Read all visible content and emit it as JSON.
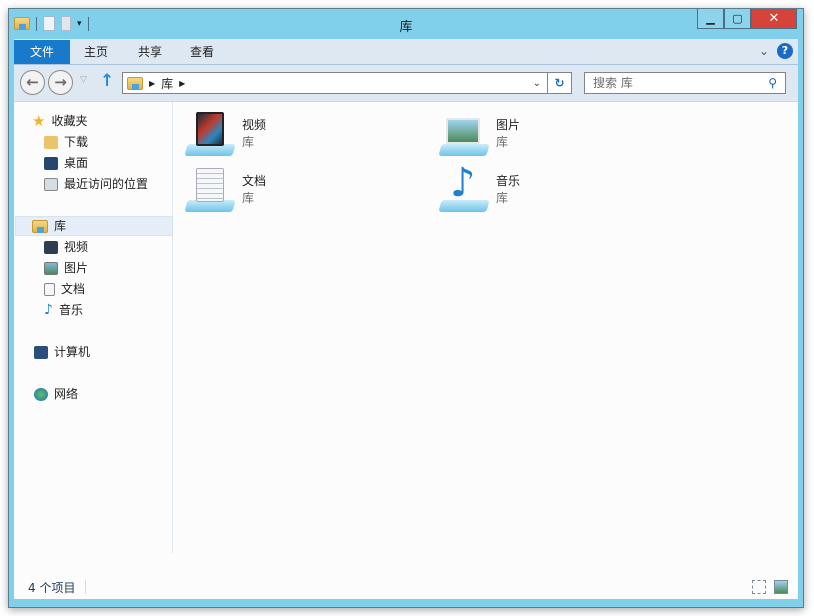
{
  "window": {
    "title": "库"
  },
  "ribbon": {
    "tabs": [
      "文件",
      "主页",
      "共享",
      "查看"
    ]
  },
  "nav": {
    "breadcrumb": [
      "库"
    ],
    "search_placeholder": "搜索 库"
  },
  "sidebar": {
    "favorites": {
      "label": "收藏夹",
      "items": [
        "下载",
        "桌面",
        "最近访问的位置"
      ]
    },
    "libraries": {
      "label": "库",
      "items": [
        "视频",
        "图片",
        "文档",
        "音乐"
      ]
    },
    "computer": "计算机",
    "network": "网络"
  },
  "items": [
    {
      "name": "视频",
      "type": "库"
    },
    {
      "name": "图片",
      "type": "库"
    },
    {
      "name": "文档",
      "type": "库"
    },
    {
      "name": "音乐",
      "type": "库"
    }
  ],
  "status": {
    "count": "4 个项目"
  },
  "colors": {
    "frame": "#80cfeb",
    "file_tab": "#1979ca",
    "close": "#d6433a"
  }
}
